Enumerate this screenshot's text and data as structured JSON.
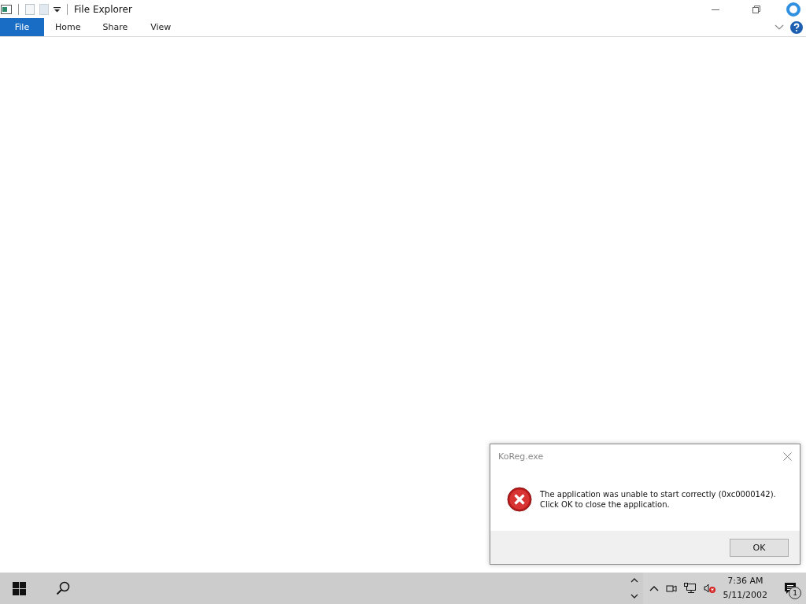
{
  "window": {
    "title": "File Explorer"
  },
  "tabs": [
    {
      "label": "File",
      "selected": true
    },
    {
      "label": "Home",
      "selected": false
    },
    {
      "label": "Share",
      "selected": false
    },
    {
      "label": "View",
      "selected": false
    }
  ],
  "dialog": {
    "title": "KoReg.exe",
    "message_lines": [
      "The application was unable to start correctly (0xc0000142).",
      "Click OK to close the application."
    ],
    "buttons": [
      "OK"
    ]
  },
  "taskbar": {
    "time": "7:36 AM",
    "date": "5/11/2002",
    "notification_count": "1"
  }
}
